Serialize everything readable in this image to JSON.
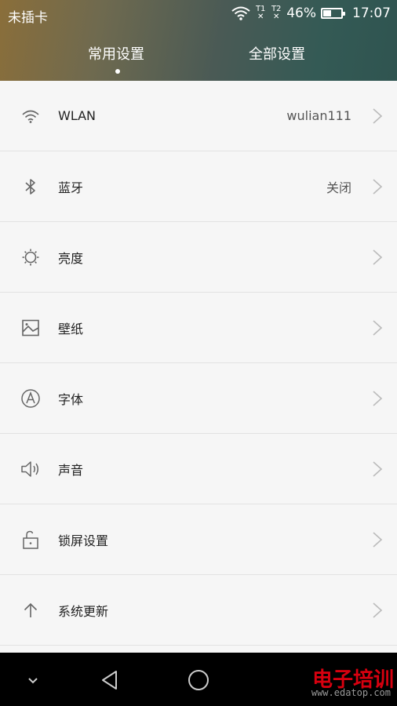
{
  "status_bar": {
    "carrier": "未插卡",
    "sim1": "T1",
    "sim2": "T2",
    "battery_percent": "46%",
    "battery_level": 0.46,
    "time": "17:07"
  },
  "tabs": [
    {
      "label": "常用设置",
      "selected": true
    },
    {
      "label": "全部设置",
      "selected": false
    }
  ],
  "settings": [
    {
      "icon": "wifi-icon",
      "label": "WLAN",
      "value": "wulian111"
    },
    {
      "icon": "bluetooth-icon",
      "label": "蓝牙",
      "value": "关闭"
    },
    {
      "icon": "brightness-icon",
      "label": "亮度",
      "value": ""
    },
    {
      "icon": "wallpaper-icon",
      "label": "壁纸",
      "value": ""
    },
    {
      "icon": "font-icon",
      "label": "字体",
      "value": ""
    },
    {
      "icon": "sound-icon",
      "label": "声音",
      "value": ""
    },
    {
      "icon": "lock-screen-icon",
      "label": "锁屏设置",
      "value": ""
    },
    {
      "icon": "system-update-icon",
      "label": "系统更新",
      "value": ""
    }
  ],
  "navbar": {
    "buttons": [
      "collapse-icon",
      "back-icon",
      "home-icon"
    ]
  },
  "watermark": {
    "title": "电子培训",
    "url": "www.edatop.com"
  },
  "colors": {
    "header_gradient_start": "#8a6e3a",
    "header_gradient_end": "#2f5450",
    "list_background": "#f6f6f6",
    "divider": "#e2e2e2",
    "navbar": "#000000",
    "watermark_red": "#d7000f"
  }
}
